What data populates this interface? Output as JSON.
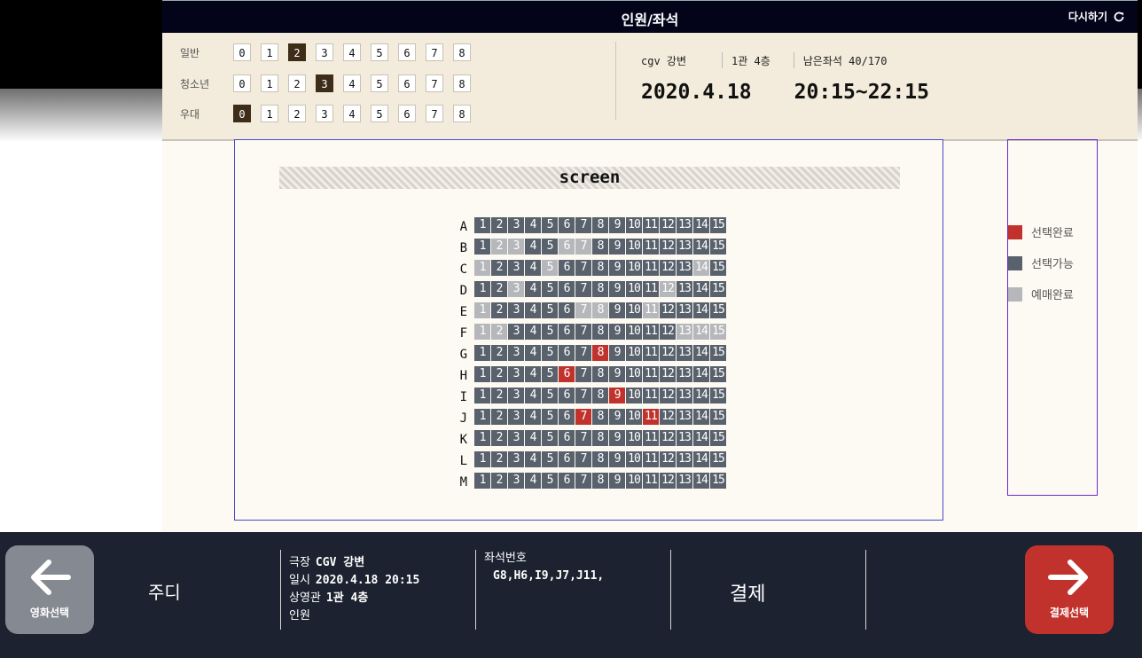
{
  "title": "인원/좌석",
  "reset_label": "다시하기",
  "people": {
    "numbers": [
      "0",
      "1",
      "2",
      "3",
      "4",
      "5",
      "6",
      "7",
      "8"
    ],
    "rows": [
      {
        "label": "일반",
        "selected_index": 2
      },
      {
        "label": "청소년",
        "selected_index": 3
      },
      {
        "label": "우대",
        "selected_index": 0
      }
    ]
  },
  "theater": {
    "name": "cgv 강변",
    "hall": "1관 4층",
    "remaining": "남은좌석 40/170",
    "date": "2020.4.18",
    "time": "20:15~22:15"
  },
  "screen_label": "screen",
  "seats": {
    "rows": [
      "A",
      "B",
      "C",
      "D",
      "E",
      "F",
      "G",
      "H",
      "I",
      "J",
      "K",
      "L",
      "M"
    ],
    "numbers": [
      "1",
      "2",
      "3",
      "4",
      "5",
      "6",
      "7",
      "8",
      "9",
      "10",
      "11",
      "12",
      "13",
      "14",
      "15"
    ],
    "booked": {
      "B": [
        2,
        3,
        6,
        7
      ],
      "C": [
        1,
        5,
        14
      ],
      "D": [
        3,
        12
      ],
      "E": [
        1,
        7,
        8,
        11
      ],
      "F": [
        1,
        2,
        13,
        14,
        15
      ]
    },
    "selected": {
      "G": [
        8
      ],
      "H": [
        6
      ],
      "I": [
        9
      ],
      "J": [
        7,
        11
      ]
    }
  },
  "legend": [
    {
      "label": "선택완료",
      "color": "#c1322d"
    },
    {
      "label": "선택가능",
      "color": "#58616c"
    },
    {
      "label": "예매완료",
      "color": "#b5b7ba"
    }
  ],
  "bottom": {
    "back_label": "영화선택",
    "movie": "주디",
    "info": [
      {
        "key": "극장",
        "value": "CGV 강변"
      },
      {
        "key": "일시",
        "value": "2020.4.18 20:15"
      },
      {
        "key": "상영관",
        "value": "1관 4층"
      },
      {
        "key": "인원",
        "value": ""
      }
    ],
    "seat_label": "좌석번호",
    "seat_value": "G8,H6,I9,J7,J11,",
    "pay_label": "결제",
    "next_label": "결제선택",
    "back_color": "#858a92",
    "next_color": "#c1322d"
  }
}
